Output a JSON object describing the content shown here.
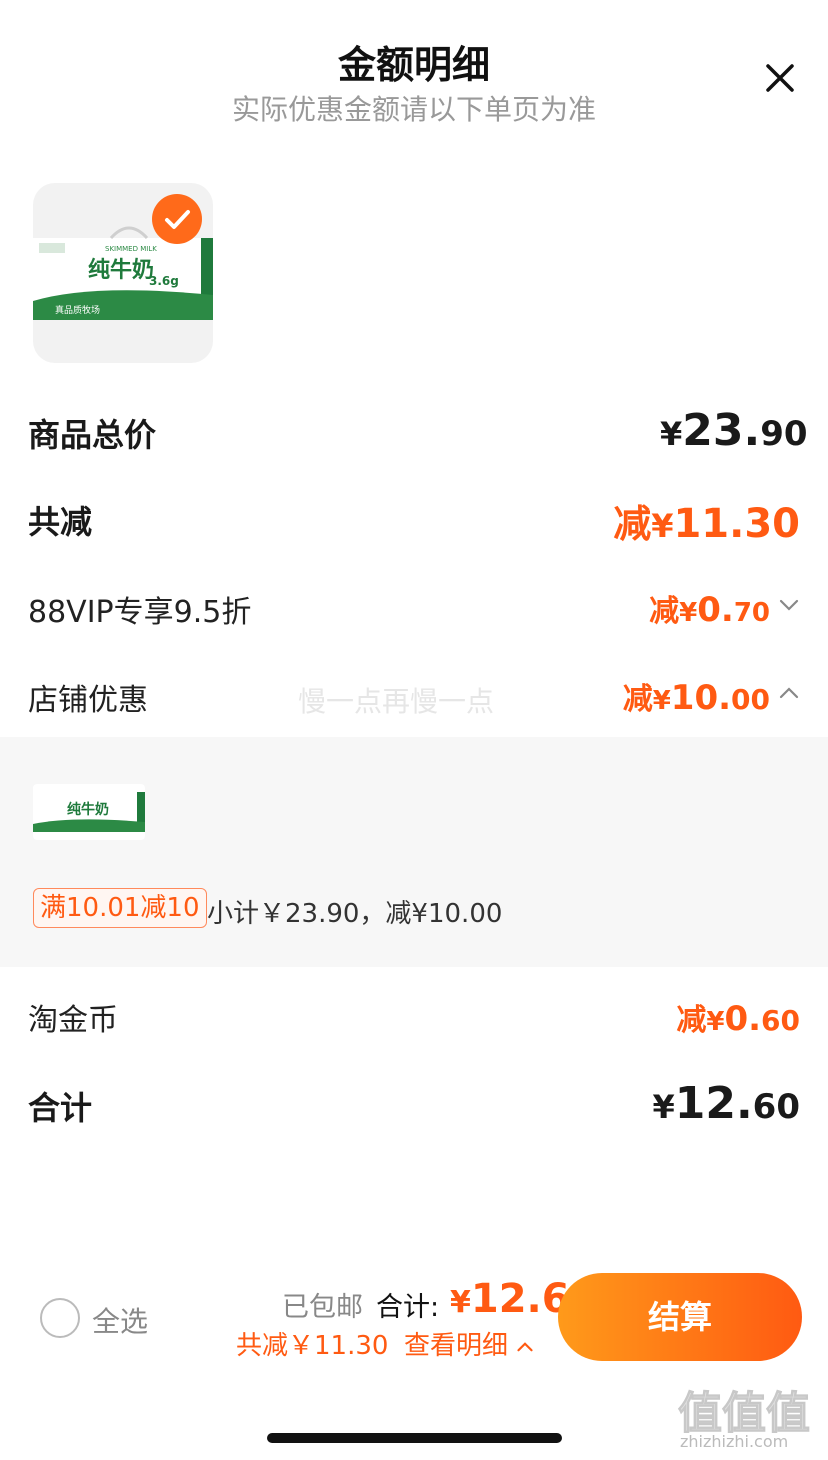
{
  "header": {
    "title": "金额明细",
    "subtitle": "实际优惠金额请以下单页为准"
  },
  "product": {
    "selected": true,
    "brand_en": "SKIMMED MILK",
    "name": "纯牛奶",
    "protein": "3.6g",
    "slogan": "真品质牧场"
  },
  "summary": {
    "total_label": "商品总价",
    "total_currency": "¥",
    "total_int": "23.",
    "total_dec": "90",
    "reduce_label": "共减",
    "reduce_prefix": "减",
    "reduce_currency": "¥",
    "reduce_value": "11.30",
    "vip_label": "88VIP专享9.5折",
    "vip_prefix": "减",
    "vip_currency": "¥",
    "vip_int": "0.",
    "vip_dec": "70",
    "shop_label": "店铺优惠",
    "shop_prefix": "减",
    "shop_currency": "¥",
    "shop_int": "10.",
    "shop_dec": "00",
    "coin_label": "淘金币",
    "coin_prefix": "减",
    "coin_currency": "¥",
    "coin_int": "0.",
    "coin_dec": "60",
    "sum_label": "合计",
    "sum_currency": "¥",
    "sum_int": "12.",
    "sum_dec": "60"
  },
  "overlay_text": "慢一点再慢一点",
  "shop_detail": {
    "tag": "满10.01减10",
    "text": "小计￥23.90，减¥10.00"
  },
  "footer": {
    "select_all": "全选",
    "shipping": "已包邮",
    "total_label": "合计:",
    "total_currency": "¥",
    "total_value": "12.6",
    "reduce_text": "共减￥11.30",
    "view_detail": "查看明细",
    "pay_button": "结算"
  },
  "watermark": {
    "logo": "值值值",
    "site": "zhizhizhi.com"
  },
  "colors": {
    "accent": "#ff5a12",
    "button_start": "#ff9a1a",
    "button_end": "#ff5a12"
  }
}
